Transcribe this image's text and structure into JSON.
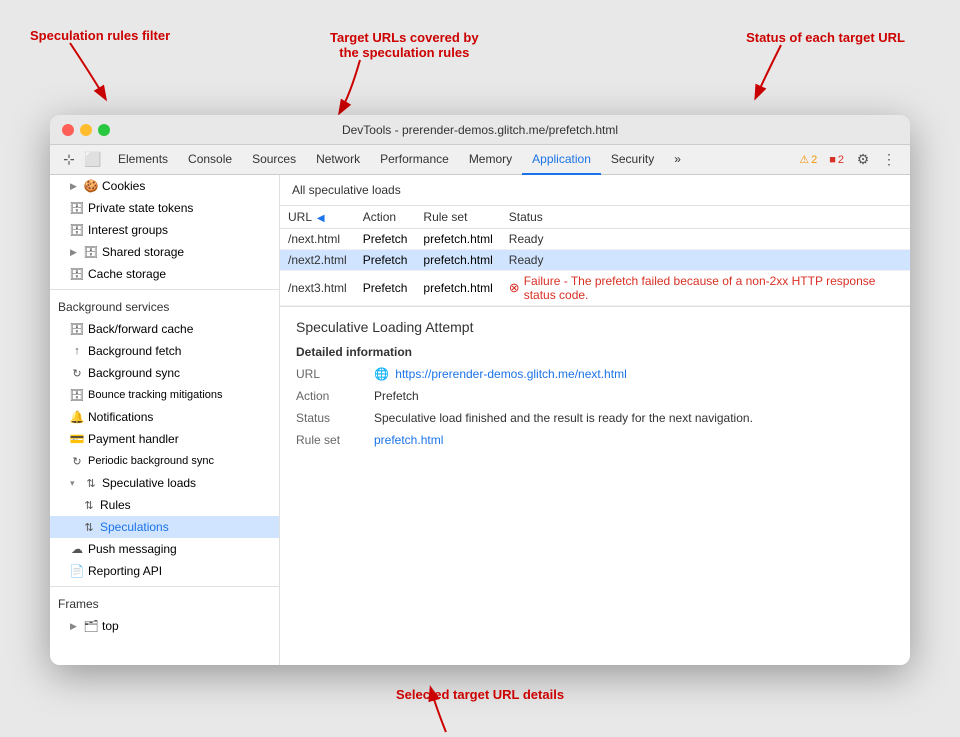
{
  "window": {
    "title": "DevTools - prerender-demos.glitch.me/prefetch.html",
    "traffic_lights": [
      "red",
      "yellow",
      "green"
    ]
  },
  "toolbar": {
    "icon_buttons": [
      "cursor-icon",
      "device-icon"
    ],
    "tabs": [
      {
        "label": "Elements",
        "active": false
      },
      {
        "label": "Console",
        "active": false
      },
      {
        "label": "Sources",
        "active": false
      },
      {
        "label": "Network",
        "active": false
      },
      {
        "label": "Performance",
        "active": false
      },
      {
        "label": "Memory",
        "active": false
      },
      {
        "label": "Application",
        "active": true
      },
      {
        "label": "Security",
        "active": false
      },
      {
        "label": "»",
        "active": false
      }
    ],
    "badges": [
      {
        "icon": "⚠",
        "count": "2",
        "type": "warn"
      },
      {
        "icon": "■",
        "count": "2",
        "type": "err"
      }
    ],
    "right_icons": [
      "gear-icon",
      "ellipsis-icon"
    ]
  },
  "sidebar": {
    "sections": [
      {
        "items": [
          {
            "label": "Cookies",
            "icon": "▶",
            "indent": 1,
            "type": "expandable"
          },
          {
            "label": "Private state tokens",
            "icon": "🗄",
            "indent": 1
          },
          {
            "label": "Interest groups",
            "icon": "🗄",
            "indent": 1
          },
          {
            "label": "Shared storage",
            "icon": "▶",
            "indent": 1,
            "type": "expandable"
          },
          {
            "label": "Cache storage",
            "icon": "🗄",
            "indent": 1
          }
        ]
      },
      {
        "header": "Background services",
        "items": [
          {
            "label": "Back/forward cache",
            "icon": "🗄",
            "indent": 1
          },
          {
            "label": "Background fetch",
            "icon": "↑",
            "indent": 1
          },
          {
            "label": "Background sync",
            "icon": "↻",
            "indent": 1
          },
          {
            "label": "Bounce tracking mitigations",
            "icon": "🗄",
            "indent": 1
          },
          {
            "label": "Notifications",
            "icon": "🔔",
            "indent": 1
          },
          {
            "label": "Payment handler",
            "icon": "💳",
            "indent": 1
          },
          {
            "label": "Periodic background sync",
            "icon": "↻",
            "indent": 1
          },
          {
            "label": "Speculative loads",
            "icon": "↑↓",
            "indent": 1,
            "type": "expandable",
            "open": true
          },
          {
            "label": "Rules",
            "icon": "↑↓",
            "indent": 2
          },
          {
            "label": "Speculations",
            "icon": "↑↓",
            "indent": 2,
            "selected": true
          },
          {
            "label": "Push messaging",
            "icon": "☁",
            "indent": 1
          },
          {
            "label": "Reporting API",
            "icon": "📄",
            "indent": 1
          }
        ]
      },
      {
        "header": "Frames",
        "items": [
          {
            "label": "top",
            "icon": "▶",
            "indent": 1,
            "type": "expandable"
          }
        ]
      }
    ]
  },
  "main": {
    "speculative_loads_header": "All speculative loads",
    "table": {
      "columns": [
        "URL",
        "Action",
        "Rule set",
        "Status"
      ],
      "rows": [
        {
          "url": "/next.html",
          "action": "Prefetch",
          "ruleset": "prefetch.html",
          "status": "Ready",
          "status_type": "ready",
          "selected": false
        },
        {
          "url": "/next2.html",
          "action": "Prefetch",
          "ruleset": "prefetch.html",
          "status": "Ready",
          "status_type": "ready",
          "selected": true
        },
        {
          "url": "/next3.html",
          "action": "Prefetch",
          "ruleset": "prefetch.html",
          "status": "Failure - The prefetch failed because of a non-2xx HTTP response status code.",
          "status_type": "error",
          "selected": false
        }
      ]
    },
    "detail_panel": {
      "title": "Speculative Loading Attempt",
      "section_title": "Detailed information",
      "rows": [
        {
          "label": "URL",
          "value": "https://prerender-demos.glitch.me/next.html",
          "type": "link"
        },
        {
          "label": "Action",
          "value": "Prefetch"
        },
        {
          "label": "Status",
          "value": "Speculative load finished and the result is ready for the next navigation."
        },
        {
          "label": "Rule set",
          "value": "prefetch.html",
          "type": "link"
        }
      ]
    }
  },
  "annotations": {
    "speculation_filter": "Speculation rules filter",
    "target_urls_line1": "Target URLs covered by",
    "target_urls_line2": "the speculation rules",
    "status": "Status of each target URL",
    "selected_details": "Selected target URL details"
  }
}
